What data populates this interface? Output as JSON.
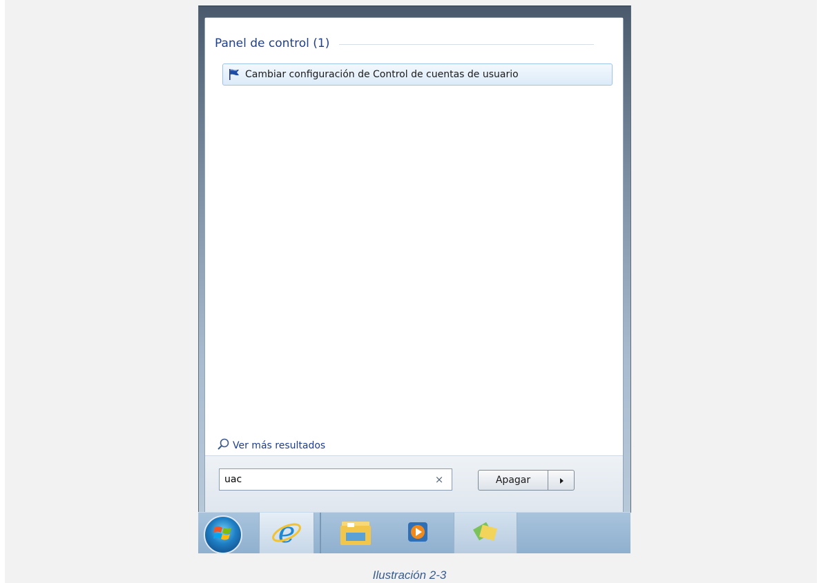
{
  "start_menu": {
    "group_title": "Panel de control (1)",
    "result_item_label": "Cambiar configuración de Control de cuentas de usuario",
    "result_item_icon": "uac-flag-icon",
    "more_results_label": "Ver más resultados",
    "more_results_icon": "search-icon"
  },
  "search": {
    "value": "uac",
    "clear_symbol": "×"
  },
  "shutdown": {
    "label": "Apagar",
    "arrow_symbol": "▸"
  },
  "taskbar": {
    "items": [
      {
        "name": "start-orb",
        "icon": "windows-logo-icon"
      },
      {
        "name": "internet-explorer",
        "icon": "ie-icon"
      },
      {
        "name": "windows-explorer",
        "icon": "folder-icon"
      },
      {
        "name": "media-player",
        "icon": "media-player-icon"
      },
      {
        "name": "photo-viewer",
        "icon": "photo-icon"
      }
    ]
  },
  "caption": "Ilustración 2-3",
  "colors": {
    "group_title": "#1e3f8a",
    "link": "#1c3d8f",
    "caption": "#3a5b8c",
    "highlight_border": "#9fc3e8"
  }
}
